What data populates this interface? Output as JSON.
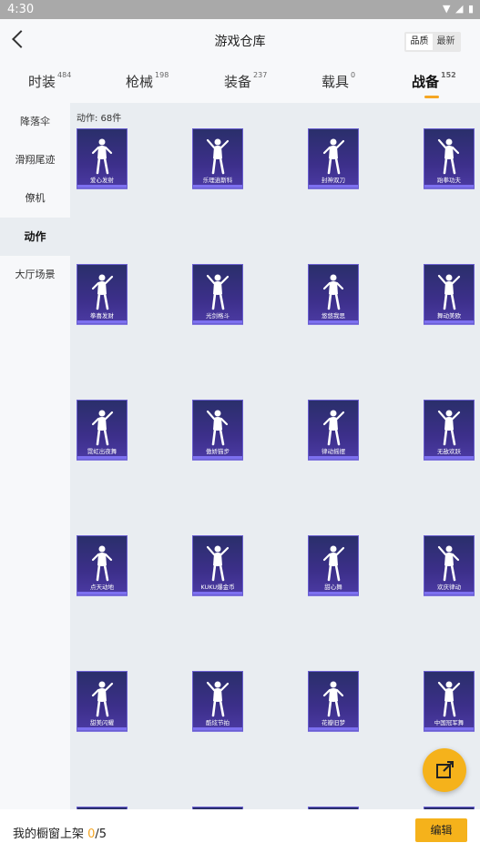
{
  "status": {
    "time": "4:30"
  },
  "header": {
    "title": "游戏仓库",
    "sort_options": [
      "品质",
      "最新"
    ],
    "sort_selected": "品质"
  },
  "tabs": [
    {
      "label": "时装",
      "count": "484",
      "active": false
    },
    {
      "label": "枪械",
      "count": "198",
      "active": false
    },
    {
      "label": "装备",
      "count": "237",
      "active": false
    },
    {
      "label": "载具",
      "count": "0",
      "active": false
    },
    {
      "label": "战备",
      "count": "152",
      "active": true
    }
  ],
  "sidebar": {
    "items": [
      {
        "label": "降落伞",
        "active": false
      },
      {
        "label": "滑翔尾迹",
        "active": false
      },
      {
        "label": "僚机",
        "active": false
      },
      {
        "label": "动作",
        "active": true
      },
      {
        "label": "大厅场景",
        "active": false
      }
    ]
  },
  "content": {
    "count_label": "动作: 68件",
    "items": [
      {
        "name": "爱心发射"
      },
      {
        "name": "乐理逍斯科"
      },
      {
        "name": "封神双刀"
      },
      {
        "name": "跆拳功夫"
      },
      {
        "name": "拳喜发财"
      },
      {
        "name": "光剑格斗"
      },
      {
        "name": "悠悠我思"
      },
      {
        "name": "舞动美欧"
      },
      {
        "name": "霓虹出夜舞"
      },
      {
        "name": "傲娇猫步"
      },
      {
        "name": "律动摇摆"
      },
      {
        "name": "无敌欢跃"
      },
      {
        "name": "点天动地"
      },
      {
        "name": "KUKU爆金币"
      },
      {
        "name": "甜心舞"
      },
      {
        "name": "欢庆律动"
      },
      {
        "name": "甜美闪耀"
      },
      {
        "name": "酷炫节拍"
      },
      {
        "name": "花瓣旧梦"
      },
      {
        "name": "中国冠军舞"
      },
      {
        "name": ""
      },
      {
        "name": ""
      },
      {
        "name": ""
      },
      {
        "name": ""
      }
    ]
  },
  "bottom": {
    "shop_label": "我的橱窗上架 ",
    "shop_current": "0",
    "shop_total": "/5",
    "edit_label": "编辑"
  },
  "colors": {
    "accent": "#f5b21b",
    "card_bg": "#3c2f8a",
    "card_border": "#6a5fd0"
  }
}
